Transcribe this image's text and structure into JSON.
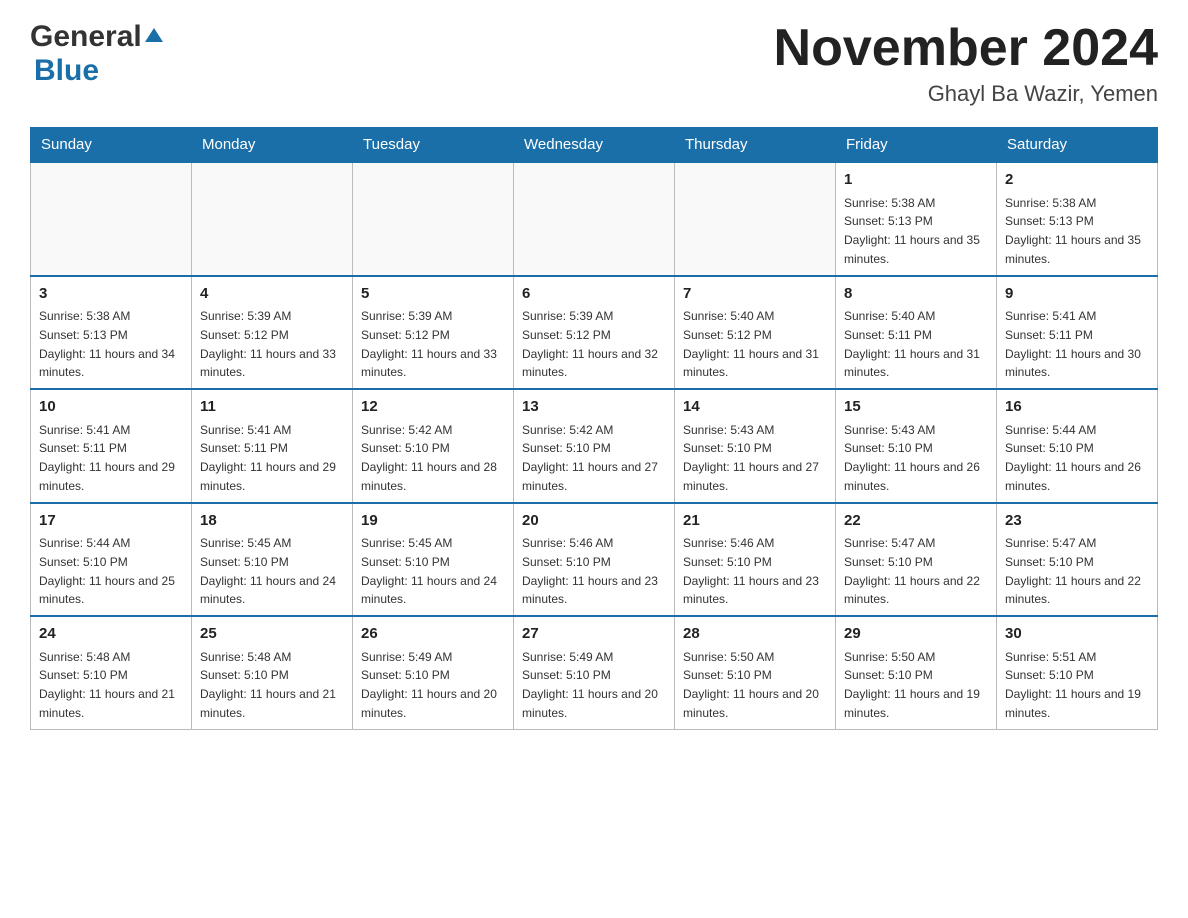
{
  "header": {
    "logo_general": "General",
    "logo_blue": "Blue",
    "month_title": "November 2024",
    "location": "Ghayl Ba Wazir, Yemen"
  },
  "weekdays": [
    "Sunday",
    "Monday",
    "Tuesday",
    "Wednesday",
    "Thursday",
    "Friday",
    "Saturday"
  ],
  "weeks": [
    [
      {
        "day": "",
        "info": ""
      },
      {
        "day": "",
        "info": ""
      },
      {
        "day": "",
        "info": ""
      },
      {
        "day": "",
        "info": ""
      },
      {
        "day": "",
        "info": ""
      },
      {
        "day": "1",
        "info": "Sunrise: 5:38 AM\nSunset: 5:13 PM\nDaylight: 11 hours and 35 minutes."
      },
      {
        "day": "2",
        "info": "Sunrise: 5:38 AM\nSunset: 5:13 PM\nDaylight: 11 hours and 35 minutes."
      }
    ],
    [
      {
        "day": "3",
        "info": "Sunrise: 5:38 AM\nSunset: 5:13 PM\nDaylight: 11 hours and 34 minutes."
      },
      {
        "day": "4",
        "info": "Sunrise: 5:39 AM\nSunset: 5:12 PM\nDaylight: 11 hours and 33 minutes."
      },
      {
        "day": "5",
        "info": "Sunrise: 5:39 AM\nSunset: 5:12 PM\nDaylight: 11 hours and 33 minutes."
      },
      {
        "day": "6",
        "info": "Sunrise: 5:39 AM\nSunset: 5:12 PM\nDaylight: 11 hours and 32 minutes."
      },
      {
        "day": "7",
        "info": "Sunrise: 5:40 AM\nSunset: 5:12 PM\nDaylight: 11 hours and 31 minutes."
      },
      {
        "day": "8",
        "info": "Sunrise: 5:40 AM\nSunset: 5:11 PM\nDaylight: 11 hours and 31 minutes."
      },
      {
        "day": "9",
        "info": "Sunrise: 5:41 AM\nSunset: 5:11 PM\nDaylight: 11 hours and 30 minutes."
      }
    ],
    [
      {
        "day": "10",
        "info": "Sunrise: 5:41 AM\nSunset: 5:11 PM\nDaylight: 11 hours and 29 minutes."
      },
      {
        "day": "11",
        "info": "Sunrise: 5:41 AM\nSunset: 5:11 PM\nDaylight: 11 hours and 29 minutes."
      },
      {
        "day": "12",
        "info": "Sunrise: 5:42 AM\nSunset: 5:10 PM\nDaylight: 11 hours and 28 minutes."
      },
      {
        "day": "13",
        "info": "Sunrise: 5:42 AM\nSunset: 5:10 PM\nDaylight: 11 hours and 27 minutes."
      },
      {
        "day": "14",
        "info": "Sunrise: 5:43 AM\nSunset: 5:10 PM\nDaylight: 11 hours and 27 minutes."
      },
      {
        "day": "15",
        "info": "Sunrise: 5:43 AM\nSunset: 5:10 PM\nDaylight: 11 hours and 26 minutes."
      },
      {
        "day": "16",
        "info": "Sunrise: 5:44 AM\nSunset: 5:10 PM\nDaylight: 11 hours and 26 minutes."
      }
    ],
    [
      {
        "day": "17",
        "info": "Sunrise: 5:44 AM\nSunset: 5:10 PM\nDaylight: 11 hours and 25 minutes."
      },
      {
        "day": "18",
        "info": "Sunrise: 5:45 AM\nSunset: 5:10 PM\nDaylight: 11 hours and 24 minutes."
      },
      {
        "day": "19",
        "info": "Sunrise: 5:45 AM\nSunset: 5:10 PM\nDaylight: 11 hours and 24 minutes."
      },
      {
        "day": "20",
        "info": "Sunrise: 5:46 AM\nSunset: 5:10 PM\nDaylight: 11 hours and 23 minutes."
      },
      {
        "day": "21",
        "info": "Sunrise: 5:46 AM\nSunset: 5:10 PM\nDaylight: 11 hours and 23 minutes."
      },
      {
        "day": "22",
        "info": "Sunrise: 5:47 AM\nSunset: 5:10 PM\nDaylight: 11 hours and 22 minutes."
      },
      {
        "day": "23",
        "info": "Sunrise: 5:47 AM\nSunset: 5:10 PM\nDaylight: 11 hours and 22 minutes."
      }
    ],
    [
      {
        "day": "24",
        "info": "Sunrise: 5:48 AM\nSunset: 5:10 PM\nDaylight: 11 hours and 21 minutes."
      },
      {
        "day": "25",
        "info": "Sunrise: 5:48 AM\nSunset: 5:10 PM\nDaylight: 11 hours and 21 minutes."
      },
      {
        "day": "26",
        "info": "Sunrise: 5:49 AM\nSunset: 5:10 PM\nDaylight: 11 hours and 20 minutes."
      },
      {
        "day": "27",
        "info": "Sunrise: 5:49 AM\nSunset: 5:10 PM\nDaylight: 11 hours and 20 minutes."
      },
      {
        "day": "28",
        "info": "Sunrise: 5:50 AM\nSunset: 5:10 PM\nDaylight: 11 hours and 20 minutes."
      },
      {
        "day": "29",
        "info": "Sunrise: 5:50 AM\nSunset: 5:10 PM\nDaylight: 11 hours and 19 minutes."
      },
      {
        "day": "30",
        "info": "Sunrise: 5:51 AM\nSunset: 5:10 PM\nDaylight: 11 hours and 19 minutes."
      }
    ]
  ]
}
